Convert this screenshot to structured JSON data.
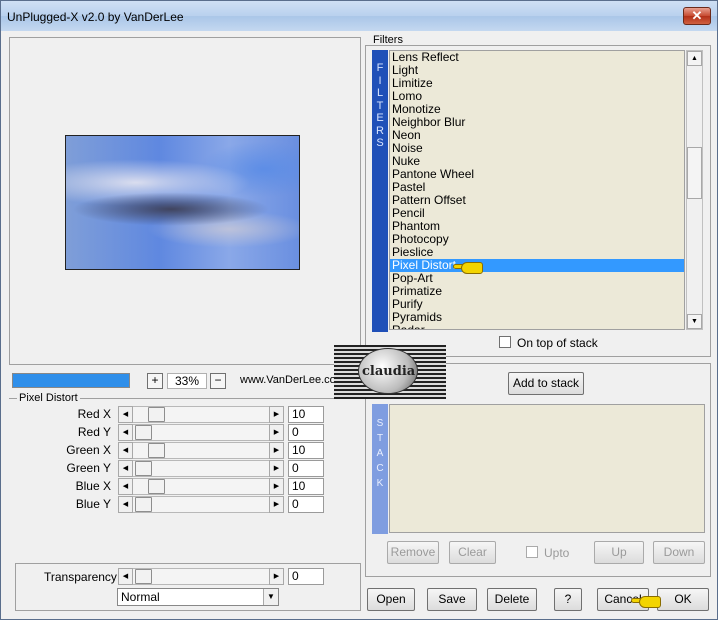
{
  "window": {
    "title": "UnPlugged-X v2.0 by VanDerLee",
    "close_label": "✕"
  },
  "preview": {
    "zoom_value": "33%",
    "zoom_in": "+",
    "zoom_out": "−",
    "website": "www.VanDerLee.com"
  },
  "params": {
    "section_title": "Pixel Distort",
    "rows": [
      {
        "label": "Red X",
        "value": "10",
        "level": 0.1
      },
      {
        "label": "Red Y",
        "value": "0",
        "level": 0.0
      },
      {
        "label": "Green X",
        "value": "10",
        "level": 0.1
      },
      {
        "label": "Green Y",
        "value": "0",
        "level": 0.0
      },
      {
        "label": "Blue X",
        "value": "10",
        "level": 0.1
      },
      {
        "label": "Blue Y",
        "value": "0",
        "level": 0.0
      }
    ],
    "transparency": {
      "label": "Transparency",
      "value": "0",
      "level": 0.0
    },
    "blend_mode": "Normal"
  },
  "filters": {
    "title": "Filters",
    "vertical_label": [
      "F",
      "I",
      "L",
      "T",
      "E",
      "R",
      "S"
    ],
    "items": [
      "Lens Reflect",
      "Light",
      "Limitize",
      "Lomo",
      "Monotize",
      "Neighbor Blur",
      "Neon",
      "Noise",
      "Nuke",
      "Pantone Wheel",
      "Pastel",
      "Pattern Offset",
      "Pencil",
      "Phantom",
      "Photocopy",
      "Pieslice",
      "Pixel Distort",
      "Pop-Art",
      "Primatize",
      "Purify",
      "Pyramids",
      "Radar"
    ],
    "selected": "Pixel Distort",
    "on_top_label": "On top of stack",
    "add_label": "Add to stack"
  },
  "stack": {
    "vertical_label": [
      "S",
      "T",
      "A",
      "C",
      "K"
    ],
    "remove": "Remove",
    "clear": "Clear",
    "upto": "Upto",
    "up": "Up",
    "down": "Down"
  },
  "footer": {
    "open": "Open",
    "save": "Save",
    "delete": "Delete",
    "help": "?",
    "cancel": "Cancel",
    "ok": "OK"
  },
  "watermark": {
    "text": "claudia"
  },
  "colors": {
    "selection": "#3399ff",
    "filters_bar": "#2050b8",
    "stack_bar": "#7f9de0",
    "progress": "#2f8fea"
  }
}
